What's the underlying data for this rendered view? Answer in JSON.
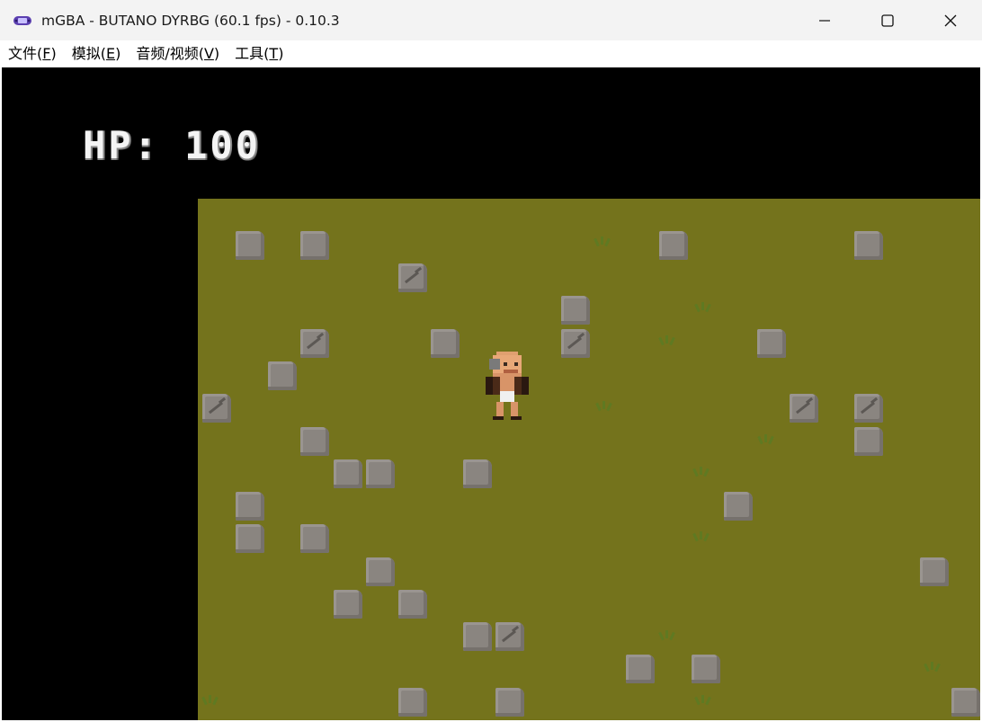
{
  "window": {
    "title": "mGBA - BUTANO DYRBG (60.1 fps) - 0.10.3",
    "app_icon": "gba-icon",
    "controls": [
      "minimize-icon",
      "maximize-icon",
      "close-icon"
    ]
  },
  "menu": [
    {
      "label_main": "文件(",
      "label_key": "F",
      "label_end": ")"
    },
    {
      "label_main": "模拟(",
      "label_key": "E",
      "label_end": ")"
    },
    {
      "label_main": "音频/视频(",
      "label_key": "V",
      "label_end": ")"
    },
    {
      "label_main": "工具(",
      "label_key": "T",
      "label_end": ")"
    }
  ],
  "game": {
    "hud_text": "HP: 100",
    "colors": {
      "background": "#000000",
      "field": "#74731c",
      "rock": "#8a8580",
      "text": "#f4f4f4"
    }
  }
}
